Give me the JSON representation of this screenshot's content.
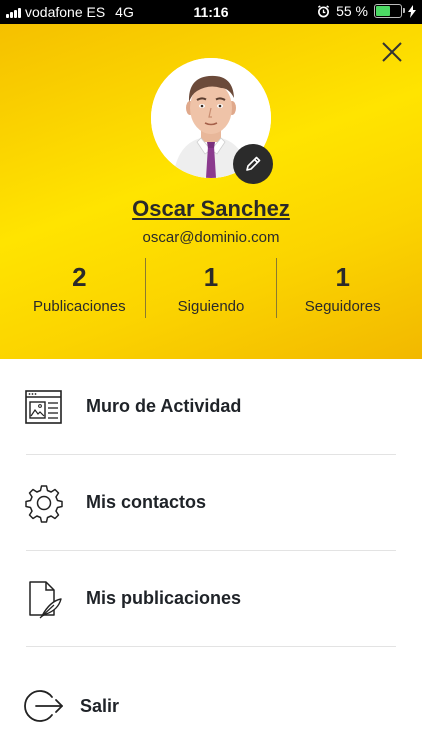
{
  "status_bar": {
    "carrier": "vodafone ES",
    "network": "4G",
    "time": "11:16",
    "battery_percent": "55 %",
    "battery_level": 0.55
  },
  "profile": {
    "name": "Oscar Sanchez",
    "email": "oscar@dominio.com"
  },
  "stats": [
    {
      "count": "2",
      "label": "Publicaciones"
    },
    {
      "count": "1",
      "label": "Siguiendo"
    },
    {
      "count": "1",
      "label": "Seguidores"
    }
  ],
  "menu": {
    "items": [
      {
        "label": "Muro de Actividad",
        "icon": "activity-wall-icon"
      },
      {
        "label": "Mis contactos",
        "icon": "gear-icon"
      },
      {
        "label": "Mis publicaciones",
        "icon": "document-feather-icon"
      }
    ],
    "logout_label": "Salir"
  },
  "colors": {
    "header_yellow": "#ffe400",
    "header_orange": "#f5c000",
    "text_dark": "#1f2328",
    "battery_green": "#4cd964"
  }
}
